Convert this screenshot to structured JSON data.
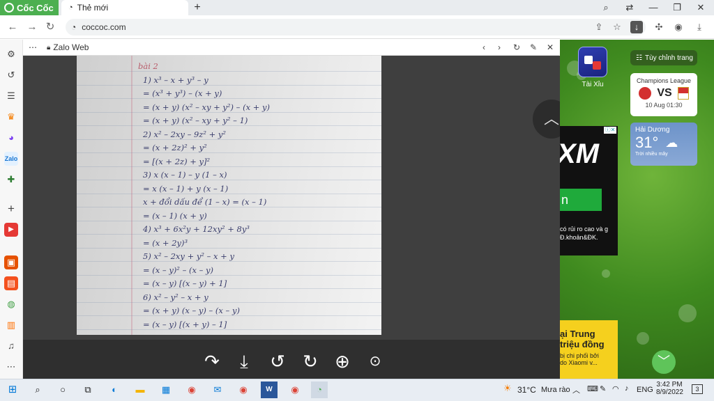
{
  "browser": {
    "brand": "Cốc Cốc",
    "tab_title": "Thẻ mới",
    "new_tab_symbol": "+",
    "url": "coccoc.com"
  },
  "zalo": {
    "title": "Zalo Web"
  },
  "notebook": {
    "lines": [
      "bài 2",
      "1)  x³ – x + y³ – y",
      "  = (x³ + y³) – (x + y)",
      "  = (x + y) (x² – xy + y²) – (x + y)",
      "  = (x + y) (x² – xy + y² – 1)",
      "2)  x² – 2xy – 9z² + y²",
      "  = (x + 2z)² + y²",
      "  = [(x + 2z) + y]²",
      "3)  x (x – 1) – y (1 – x)",
      "  = x (x – 1) + y (x – 1)",
      "  x + đổi dấu để (1 – x) = (x – 1)",
      "  = (x – 1) (x + y)",
      "4)  x³ + 6x²y + 12xy² + 8y³",
      "  = (x + 2y)³",
      "5)  x² – 2xy + y² – x + y",
      "  = (x – y)² – (x – y)",
      "  = (x – y) [(x – y) + 1]",
      "6)  x² – y² – x + y",
      "  = (x + y) (x – y) – (x – y)",
      "  = (x – y) [(x + y) – 1]"
    ]
  },
  "right_panel": {
    "game_label": "Tài Xỉu",
    "customize_label": "Tùy chỉnh trang",
    "champions": {
      "title": "Champions League",
      "vs": "VS",
      "date": "10 Aug 01:30"
    },
    "weather": {
      "city": "Hải Dương",
      "temp": "31°",
      "desc": "Trời nhiều mây"
    },
    "ad": {
      "brand": "XM",
      "text": "có rủi ro cao và g Đ.khoản&ĐK."
    },
    "ad2": {
      "line1": "ại Trung",
      "line2": "triệu đồng",
      "line3": "bị chi phối bởi",
      "line4": "do Xiaomi v..."
    }
  },
  "taskbar": {
    "weather": "31°C",
    "weather_desc": "Mưa rào",
    "lang": "ENG",
    "time": "3:42 PM",
    "date": "8/9/2022",
    "notifications": "3"
  },
  "colors": {
    "brand_green": "#4caf50",
    "viewer_bg": "#3f3f3f",
    "toolbar_bg": "#2f2f2f",
    "ink": "#3b3f6d",
    "accent_button": "#5fc45a"
  }
}
